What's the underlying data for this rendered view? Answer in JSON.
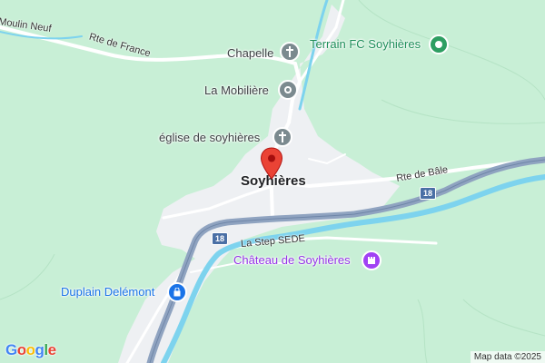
{
  "map": {
    "town_name": "Soyhières",
    "roads": {
      "moulin": "Moulin Neuf",
      "rte_france": "Rte de France",
      "rte_bale": "Rte de Bâle",
      "la_step": "La Step SEDE"
    },
    "route_number": "18",
    "places": {
      "chapelle": "Chapelle",
      "terrain": "Terrain FC Soyhières",
      "mobiliere": "La Mobilière",
      "eglise": "église de soyhières",
      "chateau": "Château de Soyhières",
      "duplain": "Duplain Delémont"
    },
    "icons": {
      "chapelle": "church-cross-icon",
      "terrain": "sports-field-icon",
      "mobiliere": "place-dot-icon",
      "eglise": "church-cross-icon",
      "chateau": "castle-icon",
      "duplain": "shopping-bag-icon",
      "marker": "red-location-pin-icon"
    },
    "colors": {
      "land": "#c8efd6",
      "water": "#7dd3ee",
      "highway": "#8fa3c0",
      "settlement": "#eef0f3",
      "marker": "#ea4335",
      "gray_poi": "#7b8a8f",
      "green_poi": "#2e9e62",
      "purple_poi": "#a142f4",
      "blue_poi": "#1a73e8"
    },
    "footer": {
      "logo_text": [
        "G",
        "o",
        "o",
        "g",
        "l",
        "e"
      ],
      "logo_colors": [
        "#4285f4",
        "#ea4335",
        "#fbbc05",
        "#4285f4",
        "#34a853",
        "#ea4335"
      ],
      "attribution": "Map data ©2025"
    }
  }
}
